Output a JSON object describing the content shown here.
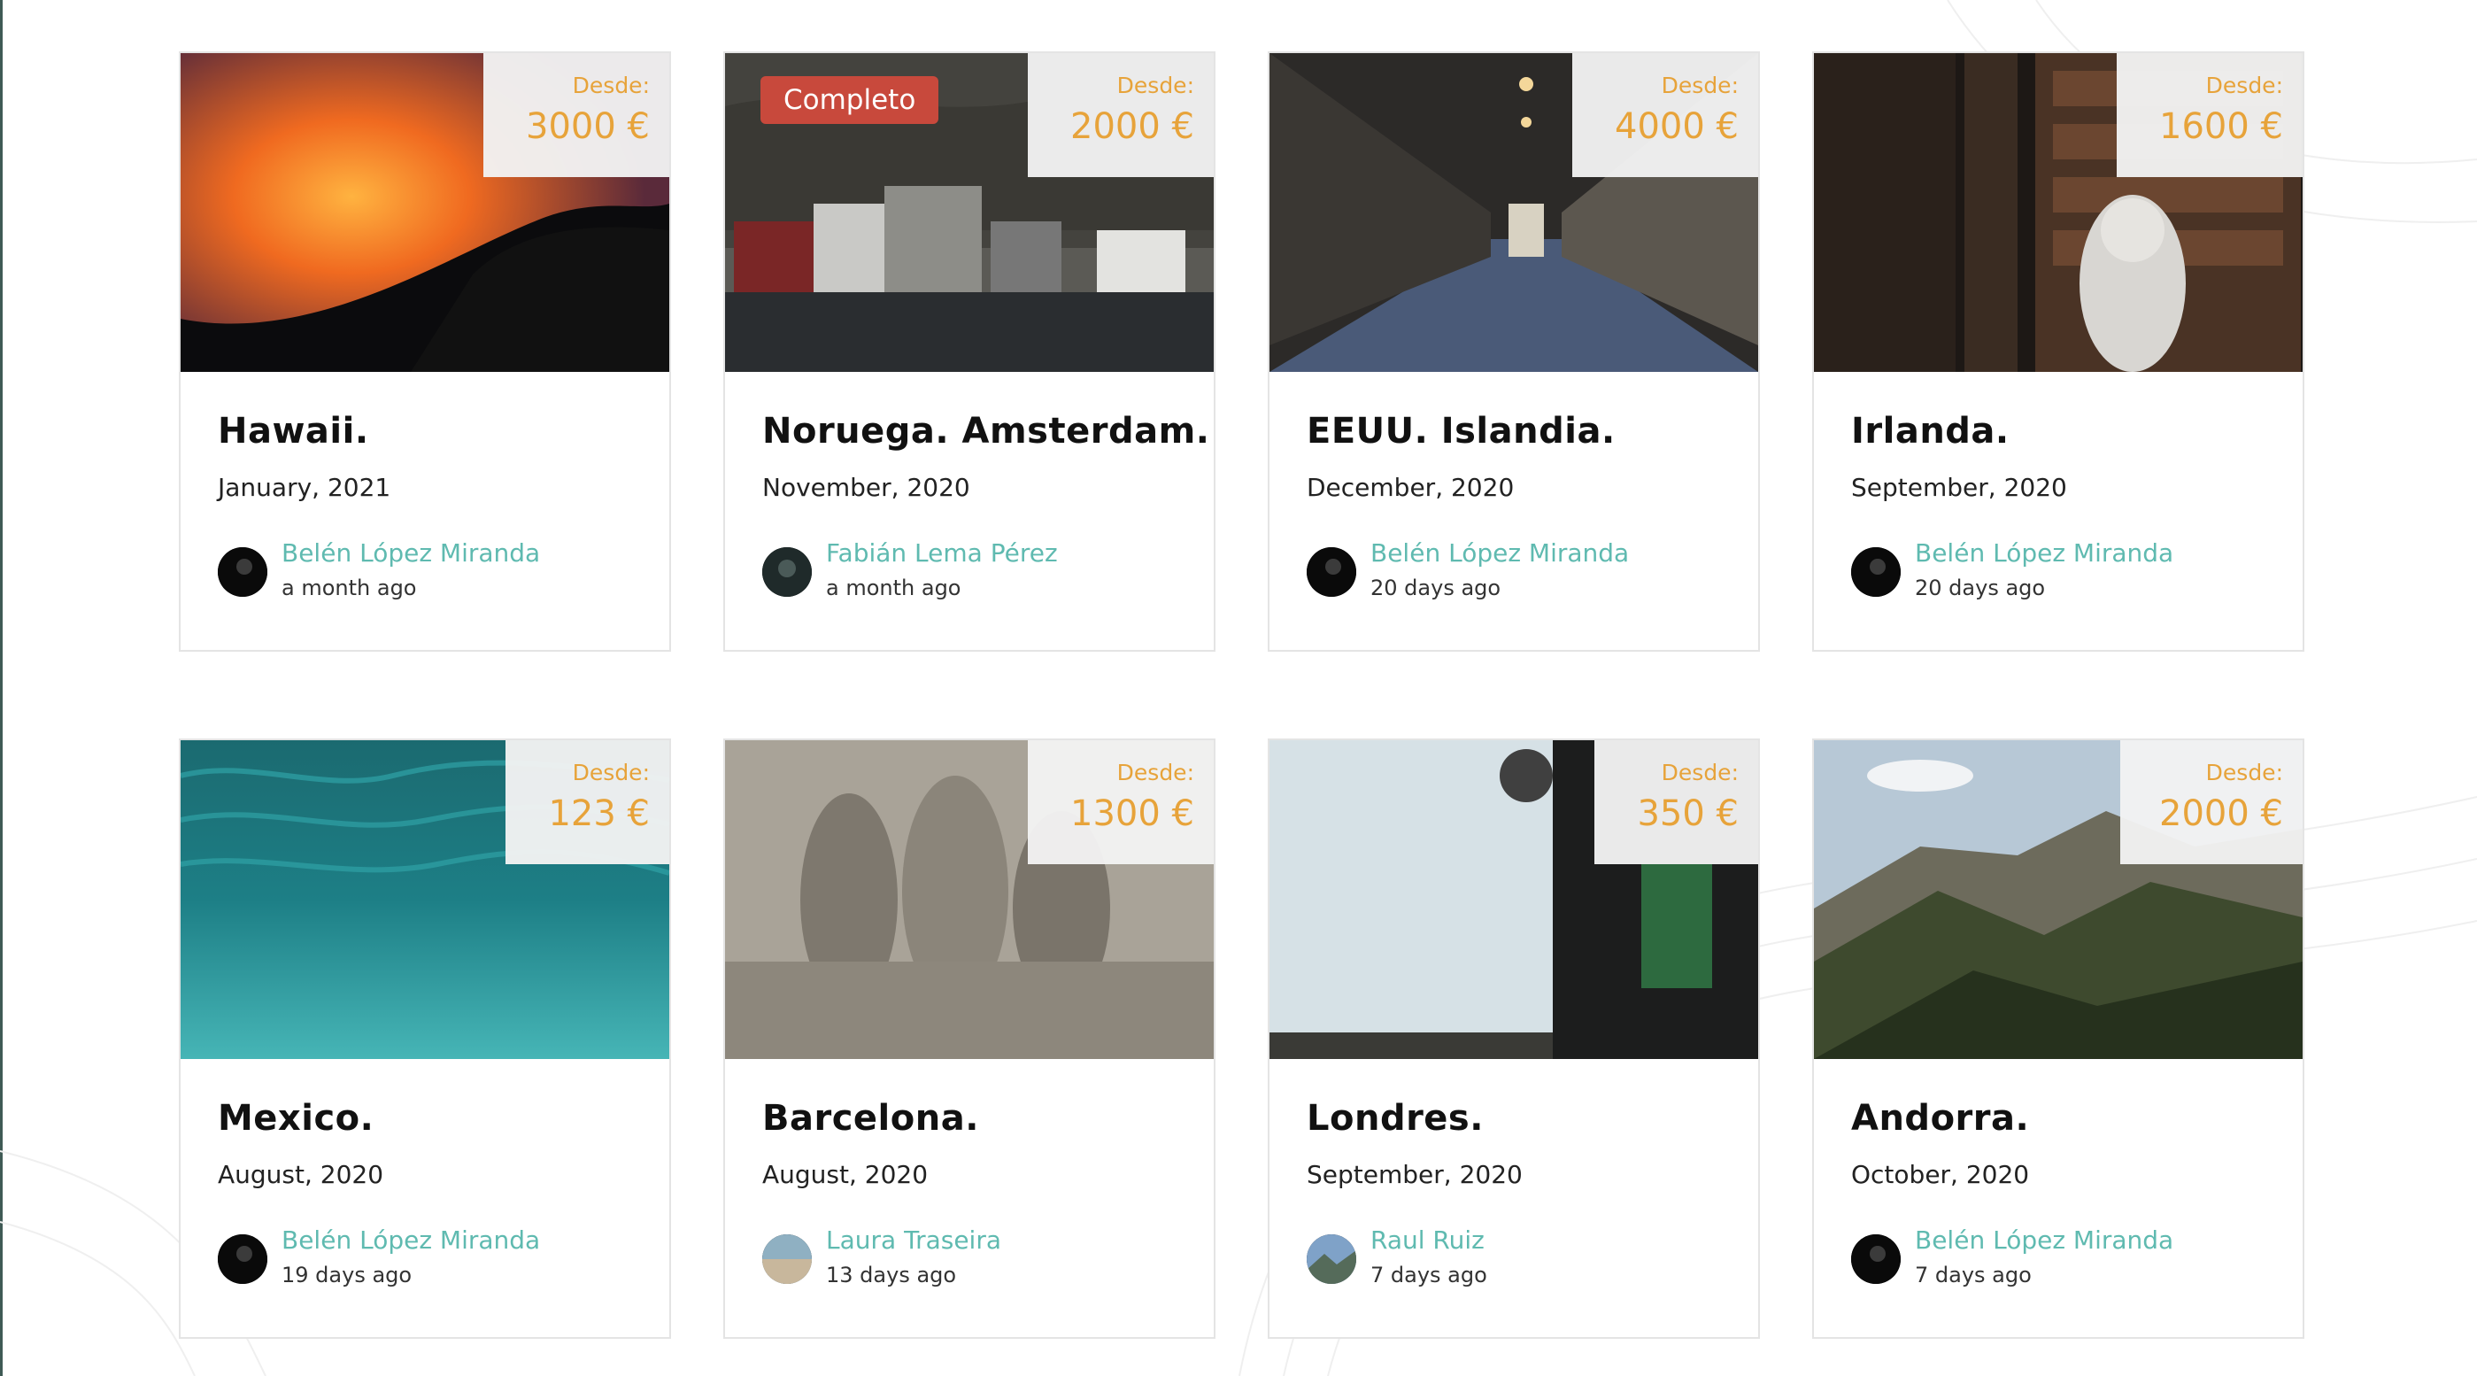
{
  "trips": [
    {
      "title": "Hawaii.",
      "date": "January, 2021",
      "price_label": "Desde:",
      "price": "3000 €",
      "author": "Belén López Miranda",
      "ago": "a month ago",
      "image": "lava-ocean-photo",
      "badge": ""
    },
    {
      "title": "Noruega. Amsterdam.",
      "date": "November, 2020",
      "price_label": "Desde:",
      "price": "2000 €",
      "author": "Fabián Lema Pérez",
      "ago": "a month ago",
      "image": "norway-houses-photo",
      "badge": "Completo"
    },
    {
      "title": "EEUU. Islandia.",
      "date": "December, 2020",
      "price_label": "Desde:",
      "price": "4000 €",
      "author": "Belén López Miranda",
      "ago": "20 days ago",
      "image": "arched-corridor-photo",
      "badge": ""
    },
    {
      "title": "Irlanda.",
      "date": "September, 2020",
      "price_label": "Desde:",
      "price": "1600 €",
      "author": "Belén López Miranda",
      "ago": "20 days ago",
      "image": "library-bust-photo",
      "badge": ""
    },
    {
      "title": "Mexico.",
      "date": "August, 2020",
      "price_label": "Desde:",
      "price": "123 €",
      "author": "Belén López Miranda",
      "ago": "19 days ago",
      "image": "underwater-photo",
      "badge": ""
    },
    {
      "title": "Barcelona.",
      "date": "August, 2020",
      "price_label": "Desde:",
      "price": "1300 €",
      "author": "Laura Traseira",
      "ago": "13 days ago",
      "image": "sagrada-familia-sculpture-photo",
      "badge": ""
    },
    {
      "title": "Londres.",
      "date": "September, 2020",
      "price_label": "Desde:",
      "price": "350 €",
      "author": "Raul Ruiz",
      "ago": "7 days ago",
      "image": "london-antennas-photo",
      "badge": ""
    },
    {
      "title": "Andorra.",
      "date": "October, 2020",
      "price_label": "Desde:",
      "price": "2000 €",
      "author": "Belén López Miranda",
      "ago": "7 days ago",
      "image": "mountain-valley-photo",
      "badge": ""
    }
  ],
  "colors": {
    "price": "#e7a33a",
    "author": "#5fbab0",
    "badge": "#c8493c"
  }
}
